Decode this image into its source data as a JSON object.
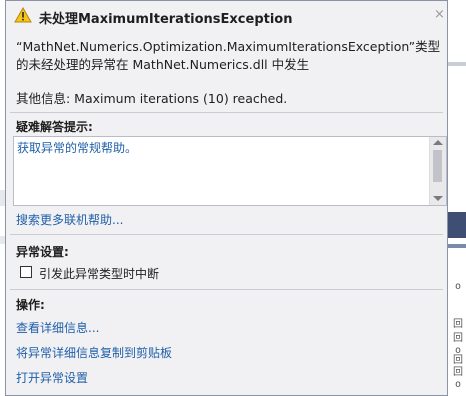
{
  "popup": {
    "title": "未处理MaximumIterationsException",
    "close_glyph": "×",
    "message": "“MathNet.Numerics.Optimization.MaximumIterationsException”类型的未经处理的异常在 MathNet.Numerics.dll 中发生",
    "additional_info": "其他信息: Maximum iterations (10) reached."
  },
  "troubleshooting": {
    "header": "疑难解答提示:",
    "tip": "获取异常的常规帮助。",
    "search_link": "搜索更多联机帮助..."
  },
  "exception_settings": {
    "header": "异常设置:",
    "break_checkbox_label": "引发此异常类型时中断",
    "break_checked": false
  },
  "actions": {
    "header": "操作:",
    "items": [
      "查看详细信息...",
      "将异常详细信息复制到剪贴板",
      "打开异常设置"
    ]
  },
  "colors": {
    "link": "#1f5fa8",
    "warning_fill": "#f5c518",
    "background": "#f1f1f4"
  },
  "icons": {
    "title": "warning-icon",
    "close": "close-icon"
  },
  "background_editor": {
    "chars": [
      "o",
      "回",
      "回",
      "o",
      "回",
      "回",
      "o"
    ]
  }
}
